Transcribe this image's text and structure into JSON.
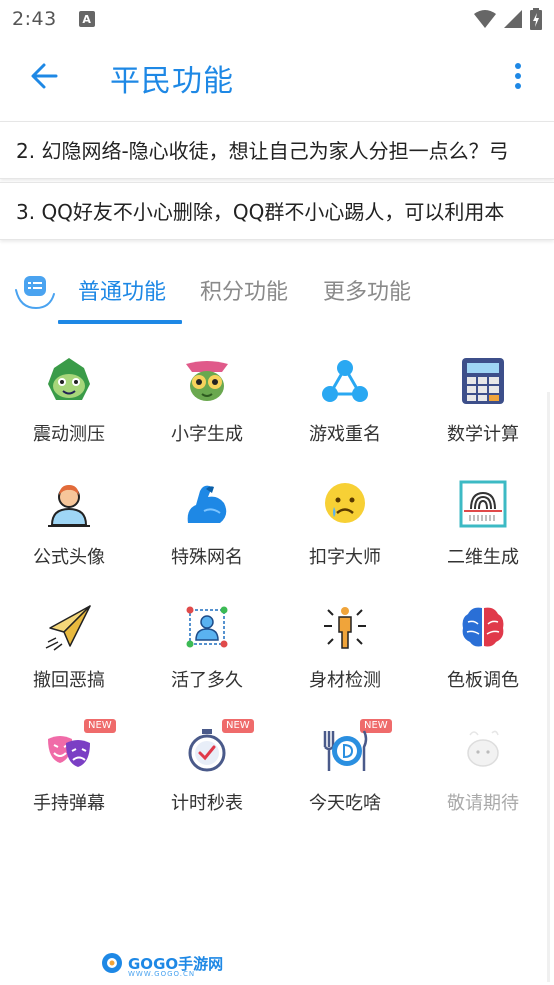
{
  "status_bar": {
    "time": "2:43",
    "notification_letter": "A"
  },
  "app_bar": {
    "title": "平民功能",
    "back_icon": "arrow-left-icon",
    "menu_icon": "more-vertical-icon"
  },
  "notices": [
    {
      "text": "2.  幻隐网络-隐心收徒，想让自己为家人分担一点么？弓"
    },
    {
      "text": "3.  QQ好友不小心删除，QQ群不小心踢人，可以利用本"
    }
  ],
  "tabs": [
    {
      "label": "普通功能",
      "active": true
    },
    {
      "label": "积分功能",
      "active": false
    },
    {
      "label": "更多功能",
      "active": false
    }
  ],
  "features": [
    {
      "label": "震动测压",
      "icon": "green-monster-icon"
    },
    {
      "label": "小字生成",
      "icon": "bug-face-icon"
    },
    {
      "label": "游戏重名",
      "icon": "share-nodes-icon"
    },
    {
      "label": "数学计算",
      "icon": "calculator-icon"
    },
    {
      "label": "公式头像",
      "icon": "person-avatar-icon"
    },
    {
      "label": "特殊网名",
      "icon": "muscle-arm-icon"
    },
    {
      "label": "扣字大师",
      "icon": "sad-face-icon"
    },
    {
      "label": "二维生成",
      "icon": "fingerprint-scan-icon"
    },
    {
      "label": "撤回恶搞",
      "icon": "paper-plane-icon"
    },
    {
      "label": "活了多久",
      "icon": "person-frame-icon"
    },
    {
      "label": "身材检测",
      "icon": "body-measure-icon"
    },
    {
      "label": "色板调色",
      "icon": "brain-icon"
    },
    {
      "label": "手持弹幕",
      "icon": "theater-masks-icon",
      "badge": "NEW"
    },
    {
      "label": "计时秒表",
      "icon": "stopwatch-icon",
      "badge": "NEW"
    },
    {
      "label": "今天吃啥",
      "icon": "plate-cutlery-icon",
      "badge": "NEW"
    },
    {
      "label": "敬请期待",
      "icon": "ghost-placeholder-icon",
      "disabled": true
    }
  ],
  "watermark": {
    "text": "GOGO手游网",
    "sub": "WWW.GOGO.CN"
  },
  "colors": {
    "accent": "#1e88e5",
    "inactive_tab": "#8a8a8a",
    "badge": "#ef6b6b"
  }
}
